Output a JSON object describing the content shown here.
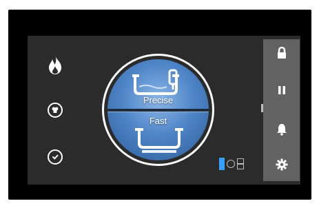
{
  "modes": {
    "top_label": "Precise",
    "bottom_label": "Fast"
  },
  "icons": {
    "left": [
      "flame-icon",
      "chef-hat-icon",
      "clock-icon"
    ],
    "sidebar": [
      "lock-icon",
      "pause-icon",
      "bell-icon",
      "gear-icon"
    ],
    "mode_indicator": [
      "blue-square-icon",
      "circle-icon",
      "split-box-icon"
    ]
  },
  "colors": {
    "accent_blue": "#4f86c8",
    "sidebar_gray": "#626262",
    "screen_bg": "#2b2b2b"
  }
}
